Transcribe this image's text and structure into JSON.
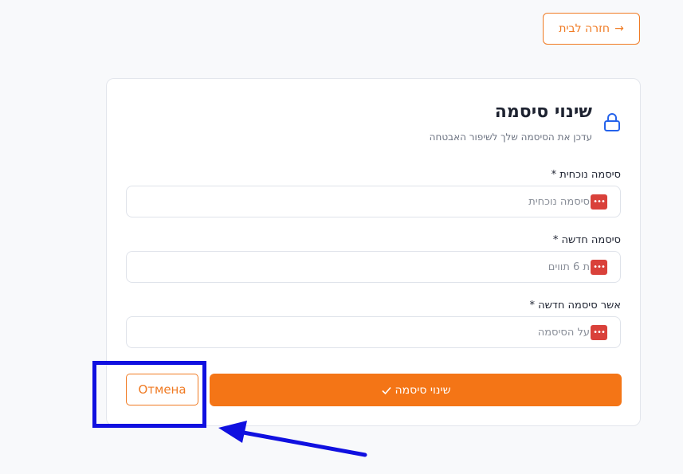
{
  "header": {
    "back_label": "חזרה לבית",
    "back_icon": "arrow-right-icon"
  },
  "card": {
    "icon": "lock-icon",
    "title": "שינוי סיסמה",
    "subtitle": "עדכן את הסיסמה שלך לשיפור האבטחה"
  },
  "form": {
    "current": {
      "label": "סיסמה נוכחית *",
      "placeholder": "סיסמה נוכחית"
    },
    "new": {
      "label": "סיסמה חדשה *",
      "placeholder": "ת 6 תווים"
    },
    "confirm": {
      "label": "אשר סיסמה חדשה *",
      "placeholder": "על הסיסמה"
    },
    "password_icon_glyph": "•••"
  },
  "actions": {
    "submit_label": "שינוי סיסמה",
    "submit_icon": "check-icon",
    "cancel_label": "Отмена"
  },
  "annotation": {
    "highlight_color": "#1010e0"
  },
  "colors": {
    "accent": "#f47516",
    "password_icon": "#d9413a"
  }
}
